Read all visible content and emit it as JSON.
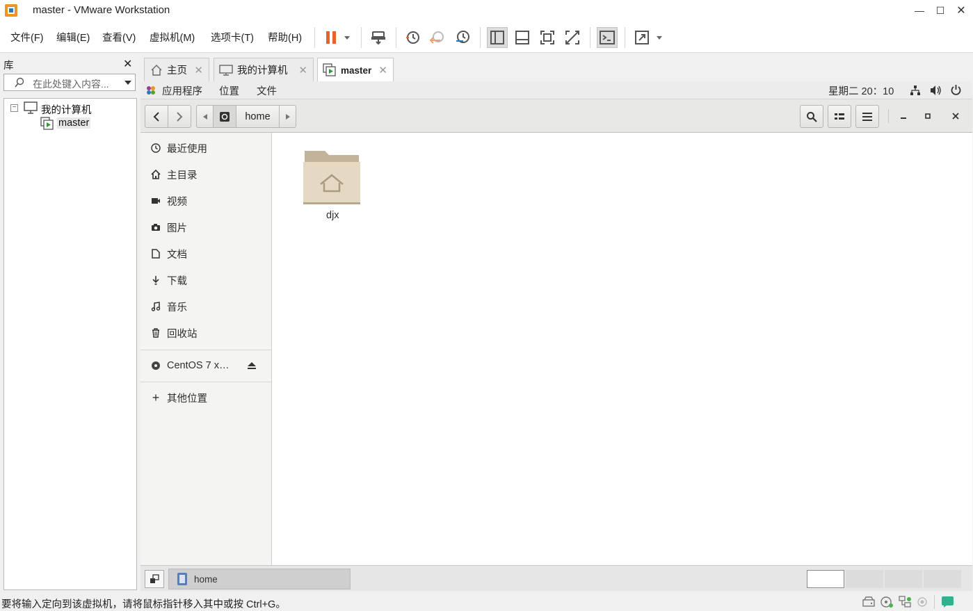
{
  "window": {
    "title": "master - VMware Workstation"
  },
  "menu": [
    "文件(F)",
    "编辑(E)",
    "查看(V)",
    "虚拟机(M)",
    "选项卡(T)",
    "帮助(H)"
  ],
  "library": {
    "title": "库",
    "search_placeholder": "在此处键入内容...",
    "tree": {
      "root": "我的计算机",
      "child": "master"
    }
  },
  "tabs": [
    {
      "label": "主页",
      "active": false
    },
    {
      "label": "我的计算机",
      "active": false
    },
    {
      "label": "master",
      "active": true
    }
  ],
  "guest": {
    "topbar": {
      "apps": "应用程序",
      "places": "位置",
      "files": "文件",
      "clock": "星期二 20：10"
    },
    "path": {
      "current": "home"
    },
    "sidebar": {
      "places": [
        "最近使用",
        "主目录",
        "视频",
        "图片",
        "文档",
        "下载",
        "音乐",
        "回收站"
      ],
      "device": "CentOS 7 x…",
      "other": "其他位置"
    },
    "files": [
      {
        "name": "djx",
        "icon": "home-folder-icon"
      }
    ],
    "taskbar": {
      "label": "home"
    }
  },
  "status": {
    "message": "要将输入定向到该虚拟机，请将鼠标指针移入其中或按 Ctrl+G。"
  },
  "colors": {
    "pause": "#e8632a",
    "accent": "#2b7bb9",
    "folder": "#e6d9c3"
  }
}
